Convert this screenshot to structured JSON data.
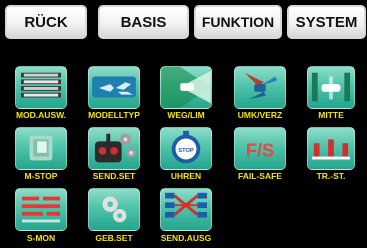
{
  "tabs": [
    {
      "label": "RÜCK"
    },
    {
      "label": "BASIS"
    },
    {
      "label": "FUNKTION"
    },
    {
      "label": "SYSTEM"
    }
  ],
  "menu": [
    {
      "label": "MOD.AUSW.",
      "icon": "model-select-icon"
    },
    {
      "label": "MODELLTYP",
      "icon": "airplane-icon"
    },
    {
      "label": "WEG/LIM",
      "icon": "servo-travel-icon"
    },
    {
      "label": "UMK/VERZ",
      "icon": "servo-reverse-icon"
    },
    {
      "label": "MITTE",
      "icon": "servo-center-icon"
    },
    {
      "label": "M-STOP",
      "icon": "motor-stop-icon"
    },
    {
      "label": "SEND.SET",
      "icon": "transmitter-icon"
    },
    {
      "label": "UHREN",
      "icon": "stopwatch-icon"
    },
    {
      "label": "FAIL-SAFE",
      "icon": "failsafe-icon"
    },
    {
      "label": "TR.-ST.",
      "icon": "trim-step-icon"
    },
    {
      "label": "S-MON",
      "icon": "servo-monitor-icon"
    },
    {
      "label": "GEB.SET",
      "icon": "gears-icon"
    },
    {
      "label": "SEND.AUSG",
      "icon": "channel-mapping-icon"
    }
  ],
  "icon_text": {
    "failsafe": "F/S",
    "stopwatch": "STOP"
  },
  "colors": {
    "background": "#000000",
    "label": "#f5e600",
    "tile": "#4fc4ab",
    "tab_text": "#111111"
  }
}
